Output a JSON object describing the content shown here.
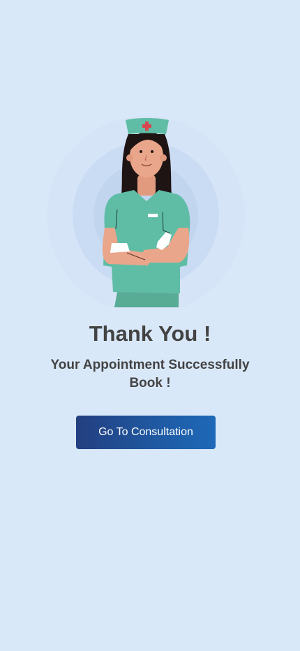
{
  "illustration": {
    "icon": "nurse-illustration",
    "colors": {
      "halo_outer": "#d6e5f8",
      "halo_mid": "#cadcf3",
      "halo_inner": "#c0d4ee",
      "scrubs": "#5fbda6",
      "scrubs_dark": "#58ab95",
      "skin": "#eaa68a",
      "hair": "#1f1414",
      "cross": "#d8474f"
    }
  },
  "confirmation": {
    "title": "Thank You !",
    "message": "Your Appointment Successfully Book !"
  },
  "actions": {
    "primary_label": "Go To Consultation"
  },
  "theme": {
    "background": "#d9e8f9",
    "text": "#434343",
    "button_start": "#233f80",
    "button_end": "#1e69b8"
  }
}
